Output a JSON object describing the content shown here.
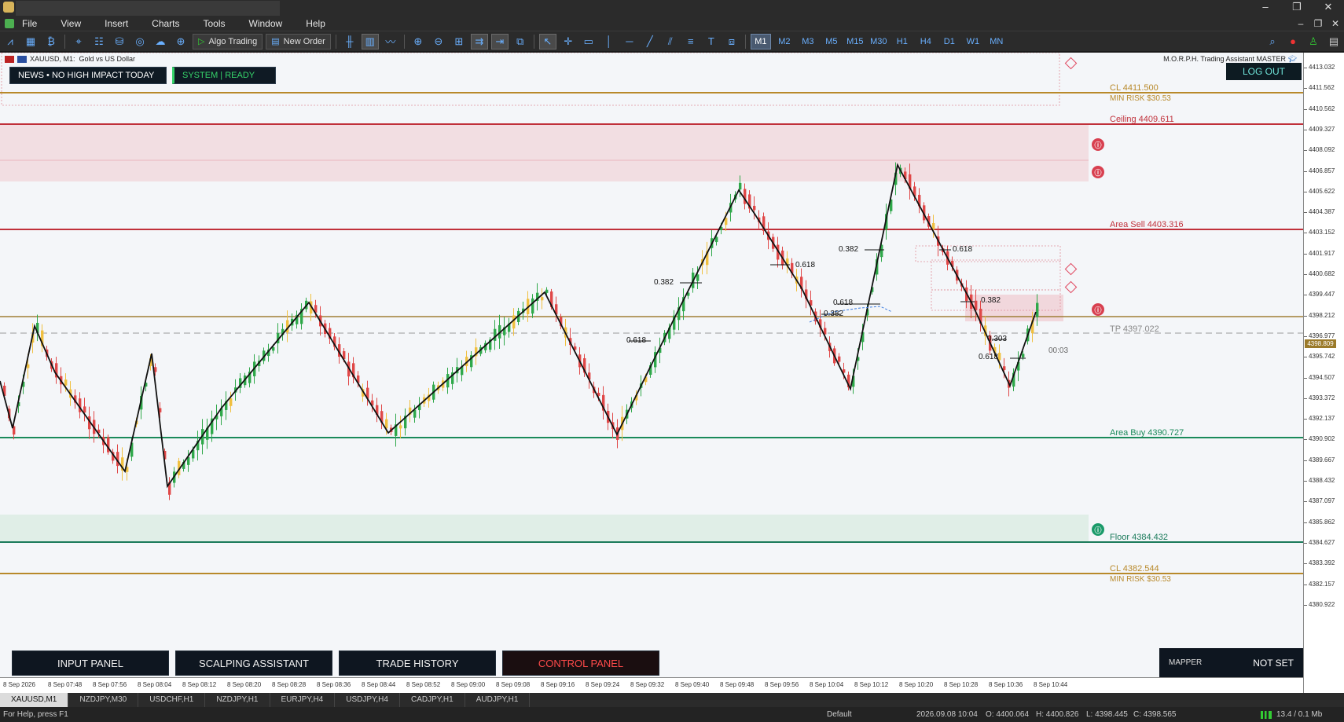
{
  "menu": {
    "items": [
      "File",
      "View",
      "Insert",
      "Charts",
      "Tools",
      "Window",
      "Help"
    ]
  },
  "toolbar": {
    "algo_trading": "Algo Trading",
    "new_order": "New Order",
    "timeframes": [
      "M1",
      "M2",
      "M3",
      "M5",
      "M15",
      "M30",
      "H1",
      "H4",
      "D1",
      "W1",
      "MN"
    ],
    "selected_timeframe": "M1"
  },
  "chart": {
    "symbol": "XAUUSD, M1:",
    "symbol_desc": "Gold vs US Dollar",
    "ea_name": "M.O.R.P.H. Trading Assistant MASTER",
    "news_badge": "NEWS • NO HIGH IMPACT TODAY",
    "system_badge": "SYSTEM  |  READY",
    "logout": "LOG OUT",
    "countdown": "00:03",
    "current_price": "4398.809",
    "levels": {
      "cl_top": "CL 4411.500",
      "min_risk_top": "MIN RISK $30.53",
      "ceiling": "Ceiling 4409.611",
      "area_sell": "Area Sell 4403.316",
      "tp": "TP 4397.022",
      "area_buy": "Area Buy 4390.727",
      "floor": "Floor 4384.432",
      "cl_bottom": "CL 4382.544",
      "min_risk_bottom": "MIN RISK $30.53"
    },
    "fib_labels": [
      "0.382",
      "0.618",
      "0.382",
      "0.618",
      "0.618",
      "0.382",
      "0.618",
      "0.382",
      "0.303",
      "0.618"
    ],
    "price_ticks": [
      "4413.032",
      "4411.562",
      "4410.562",
      "4409.327",
      "4408.092",
      "4406.857",
      "4405.622",
      "4404.387",
      "4403.152",
      "4401.917",
      "4400.682",
      "4399.447",
      "4398.212",
      "4396.977",
      "4395.742",
      "4394.507",
      "4393.372",
      "4392.137",
      "4390.902",
      "4389.667",
      "4388.432",
      "4387.097",
      "4385.862",
      "4384.627",
      "4383.392",
      "4382.157",
      "4380.922"
    ],
    "time_ticks": [
      "8 Sep 2026",
      "8 Sep 07:48",
      "8 Sep 07:56",
      "8 Sep 08:04",
      "8 Sep 08:12",
      "8 Sep 08:20",
      "8 Sep 08:28",
      "8 Sep 08:36",
      "8 Sep 08:44",
      "8 Sep 08:52",
      "8 Sep 09:00",
      "8 Sep 09:08",
      "8 Sep 09:16",
      "8 Sep 09:24",
      "8 Sep 09:32",
      "8 Sep 09:40",
      "8 Sep 09:48",
      "8 Sep 09:56",
      "8 Sep 10:04",
      "8 Sep 10:12",
      "8 Sep 10:20",
      "8 Sep 10:28",
      "8 Sep 10:36",
      "8 Sep 10:44"
    ]
  },
  "panels": {
    "input": "INPUT PANEL",
    "scalping": "SCALPING ASSISTANT",
    "history": "TRADE HISTORY",
    "control": "CONTROL PANEL",
    "mapper": "MAPPER",
    "mapper_value": "NOT SET"
  },
  "tabs": [
    "XAUUSD,M1",
    "NZDJPY,M30",
    "USDCHF,H1",
    "NZDJPY,H1",
    "EURJPY,H4",
    "USDJPY,H4",
    "CADJPY,H1",
    "AUDJPY,H1"
  ],
  "status": {
    "help": "For Help, press F1",
    "profile": "Default",
    "datetime": "2026.09.08 10:04",
    "open": "O: 4400.064",
    "high": "H: 4400.826",
    "low": "L: 4398.445",
    "close": "C: 4398.565",
    "traffic": "13.4 / 0.1 Mb"
  },
  "colors": {
    "ceiling": "#c0303a",
    "area_sell": "#c0303a",
    "area_buy": "#1a8a5a",
    "floor": "#1a7a5a",
    "cl": "#b8892a",
    "tp": "#999999",
    "bull": "#2fa84a",
    "bear": "#e04848",
    "neutral": "#f0c040"
  }
}
